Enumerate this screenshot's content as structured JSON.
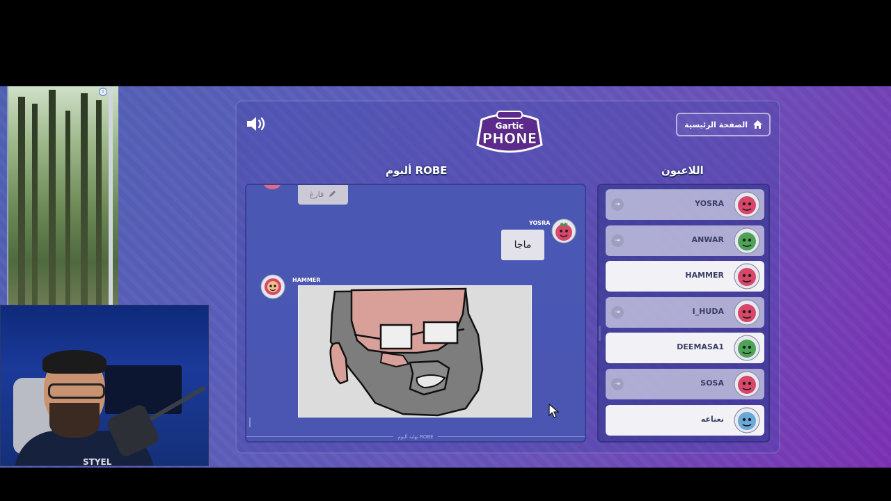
{
  "header": {
    "home_label": "الصفحة الرئيسية",
    "logo_top": "Gartic",
    "logo_bottom": "PHONE"
  },
  "album": {
    "title": "ألبوم ROBE",
    "empty_label": "فارغ",
    "entries": [
      {
        "player": "YOSRA",
        "text": "ماجا"
      },
      {
        "player": "HAMMER",
        "type": "drawing"
      }
    ],
    "end_label": "نهاية ألبوم ROBE"
  },
  "players": {
    "title": "اللاعبون",
    "list": [
      {
        "name": "YOSRA",
        "avatar": "red-strawberry-face-icon",
        "color": "#d8476a",
        "kick": true
      },
      {
        "name": "ANWAR",
        "avatar": "green-frog-face-icon",
        "color": "#4ea357",
        "kick": true
      },
      {
        "name": "HAMMER",
        "avatar": "donut-face-icon",
        "color": "#d8476a",
        "kick": false
      },
      {
        "name": "I_HUDA",
        "avatar": "red-angry-face-icon",
        "color": "#d8476a",
        "kick": true
      },
      {
        "name": "DEEMASA1",
        "avatar": "green-monster-face-icon",
        "color": "#4ea357",
        "kick": false
      },
      {
        "name": "SOSA",
        "avatar": "red-strawberry-face-icon",
        "color": "#d8476a",
        "kick": true
      },
      {
        "name": "نعناعه",
        "avatar": "goggles-face-icon",
        "color": "#6aa8d8",
        "kick": false
      }
    ]
  },
  "webcam": {
    "shirt_text": "STYEL"
  },
  "colors": {
    "accent_purple": "#7a2fb2",
    "accent_blue": "#4f5fb2",
    "title_text": "#ffffff"
  }
}
